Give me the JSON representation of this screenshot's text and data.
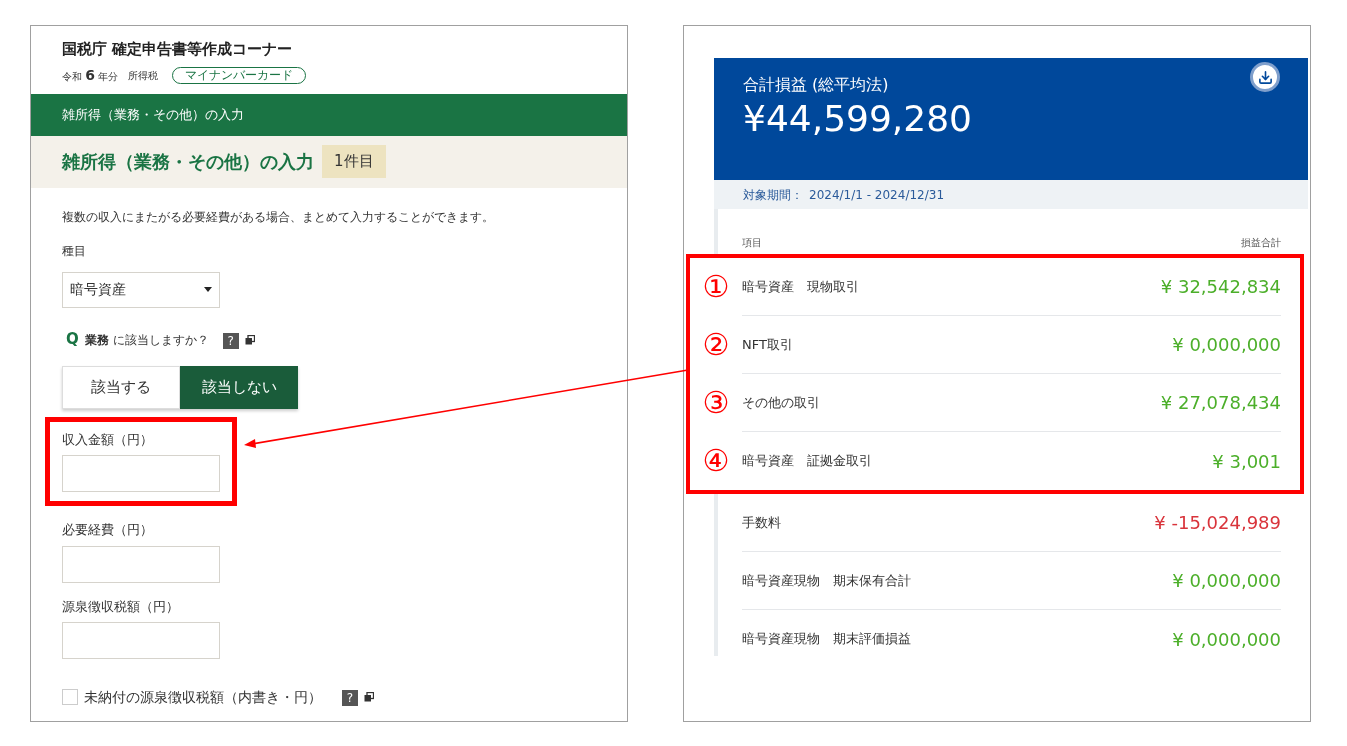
{
  "tax_form": {
    "site_title": "国税庁 確定申告書等作成コーナー",
    "era": "令和",
    "year": "6",
    "year_suffix": "年分",
    "tax_type": "所得税",
    "auth_badge": "マイナンバーカード",
    "breadcrumb": "雑所得（業務・その他）の入力",
    "page_title": "雑所得（業務・その他）の入力",
    "item_badge": "1件目",
    "description": "複数の収入にまたがる必要経費がある場合、まとめて入力することができます。",
    "category_label": "種目",
    "category_value": "暗号資産",
    "question": {
      "icon": "Q",
      "text": "**業務** に該当しますか？",
      "help": "?"
    },
    "answer_toggle": [
      {
        "label": "該当する",
        "selected": false
      },
      {
        "label": "該当しない",
        "selected": true
      }
    ],
    "fields": [
      {
        "label": "収入金額（円）",
        "highlighted": true
      },
      {
        "label": "必要経費（円）",
        "highlighted": false
      },
      {
        "label": "源泉徴収税額（円）",
        "highlighted": false
      }
    ],
    "unpaid_checkbox": {
      "label": "未納付の源泉徴収税額（内書き・円）",
      "checked": false,
      "help": "?"
    }
  },
  "profit_report": {
    "title": "合計損益 (総平均法)",
    "total": "¥44,599,280",
    "period_label": "対象期間：",
    "period": "2024/1/1 - 2024/12/31",
    "columns": [
      "項目",
      "損益合計"
    ],
    "highlighted_rows": [
      {
        "marker": "①",
        "label": "暗号資産　現物取引",
        "value": "¥ 32,542,834",
        "color": "#4caf2a"
      },
      {
        "marker": "②",
        "label": "NFT取引",
        "value": "¥ 0,000,000",
        "color": "#4caf2a"
      },
      {
        "marker": "③",
        "label": "その他の取引",
        "value": "¥ 27,078,434",
        "color": "#4caf2a"
      },
      {
        "marker": "④",
        "label": "暗号資産　証拠金取引",
        "value": "¥ 3,001",
        "color": "#4caf2a"
      }
    ],
    "other_rows": [
      {
        "label": "手数料",
        "value": "¥ -15,024,989",
        "color": "#d9343b"
      },
      {
        "label": "暗号資産現物　期末保有合計",
        "value": "¥ 0,000,000",
        "color": "#4caf2a"
      },
      {
        "label": "暗号資産現物　期末評価損益",
        "value": "¥ 0,000,000",
        "color": "#4caf2a"
      }
    ]
  }
}
